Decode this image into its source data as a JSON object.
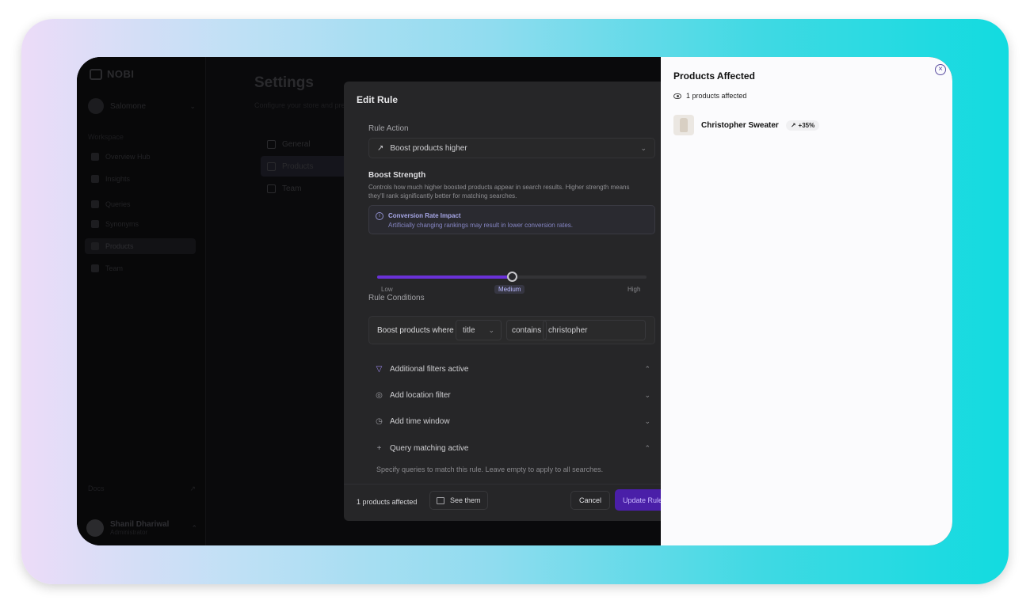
{
  "sidebar": {
    "logo": "NOBI",
    "workspace": "Salomone",
    "group": "Workspace",
    "items": [
      {
        "label": "Overview Hub"
      },
      {
        "label": "Insights"
      },
      {
        "label": "Queries"
      },
      {
        "label": "Synonyms"
      },
      {
        "label": "Products"
      },
      {
        "label": "Team"
      }
    ],
    "footer_label": "Docs",
    "user_name": "Shanil Dhariwal",
    "user_sub": "Administrator"
  },
  "settings": {
    "title": "Settings",
    "subtitle": "Configure your store and preferences",
    "tabs": [
      {
        "label": "General"
      },
      {
        "label": "Products"
      },
      {
        "label": "Team"
      }
    ]
  },
  "dialog": {
    "title": "Edit Rule",
    "rule_action_label": "Rule Action",
    "rule_action_value": "Boost products higher",
    "boost_title": "Boost Strength",
    "boost_desc": "Controls how much higher boosted products appear in search results. Higher strength means they'll rank significantly better for matching searches.",
    "impact_title": "Conversion Rate Impact",
    "impact_desc": "Artificially changing rankings may result in lower conversion rates.",
    "slider": {
      "value_fraction": 0.5,
      "low": "Low",
      "medium": "Medium",
      "high": "High"
    },
    "conditions_label": "Rule Conditions",
    "condition": {
      "prefix": "Boost products where",
      "field": "title",
      "operator": "contains",
      "value": "christopher"
    },
    "accordions": [
      {
        "label": "Additional filters active",
        "icon": "filter-icon",
        "open": true
      },
      {
        "label": "Add location filter",
        "icon": "location-icon",
        "open": false
      },
      {
        "label": "Add time window",
        "icon": "clock-icon",
        "open": false
      },
      {
        "label": "Query matching active",
        "icon": "plus-icon",
        "open": true
      }
    ],
    "query_hint": "Specify queries to match this rule. Leave empty to apply to all searches.",
    "footer": {
      "affected": "1 products affected",
      "see_them": "See them",
      "cancel": "Cancel",
      "update": "Update Rule"
    }
  },
  "panel": {
    "title": "Products Affected",
    "count": "1 products affected",
    "products": [
      {
        "name": "Christopher Sweater",
        "badge": "+35%"
      }
    ]
  },
  "colors": {
    "accent": "#6a31d8",
    "panel_bg": "#fbfbfd",
    "dialog_bg": "#262628"
  }
}
